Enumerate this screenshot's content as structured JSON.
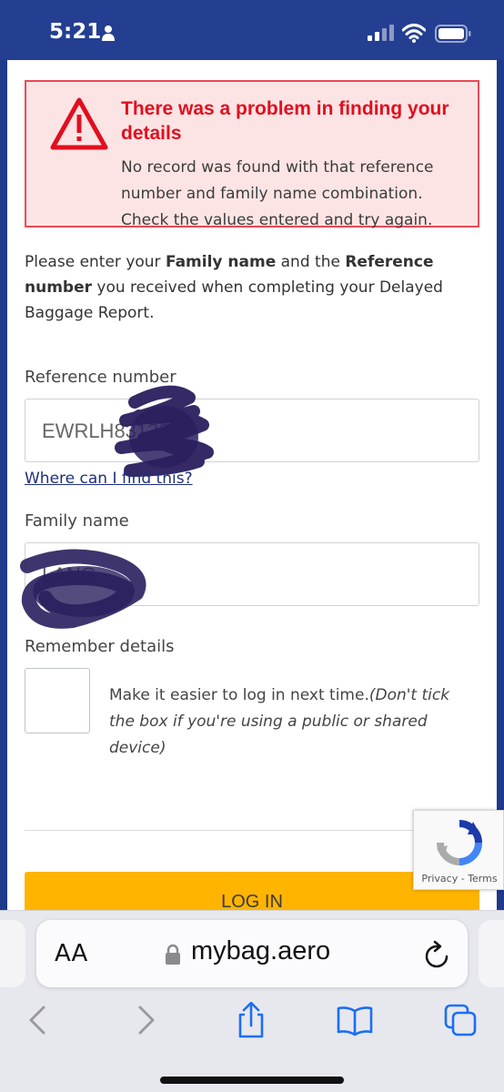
{
  "status_bar": {
    "time": "5:21"
  },
  "error": {
    "title": "There was a problem in finding your details",
    "message": "No record was found with that reference number and family name combination. Check the values entered and try again."
  },
  "intro": {
    "part1": "Please enter your ",
    "family_name_bold": "Family name",
    "part2": " and the ",
    "reference_bold": "Reference number",
    "part3": " you received when completing your Delayed Baggage Report."
  },
  "form": {
    "reference_label": "Reference number",
    "reference_value": "EWRLH83133",
    "help_link": "Where can I find this?",
    "family_label": "Family name",
    "family_value": "LANG",
    "remember_label": "Remember details",
    "remember_text": "Make it easier to log in next time.",
    "remember_note": "(Don't tick the box if you're using a public or shared device)",
    "login_label": "LOG IN"
  },
  "recaptcha": {
    "privacy": "Privacy",
    "separator": " - ",
    "terms": "Terms"
  },
  "browser": {
    "aa_label": "AA",
    "url": "mybag.aero"
  },
  "colors": {
    "header": "#243f91",
    "error_red": "#e10f1f",
    "button_yellow": "#ffb400",
    "scribble": "#2a1f5e"
  }
}
